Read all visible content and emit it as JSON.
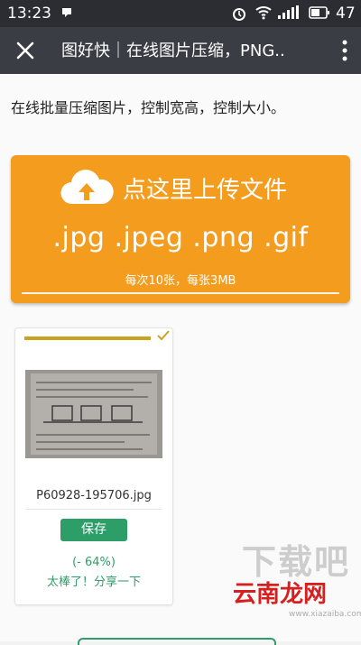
{
  "status_bar": {
    "time": "13:23",
    "battery": "47"
  },
  "title_bar": {
    "title": "图好快｜在线图片压缩，PNG.."
  },
  "main": {
    "intro": "在线批量压缩图片，控制宽高，控制大小。",
    "upload": {
      "title": "点这里上传文件",
      "extensions": ".jpg .jpeg .png .gif",
      "limit": "每次10张，每张3MB"
    },
    "file_card": {
      "filename": "P60928-195706.jpg",
      "save_label": "保存",
      "ratio": "(- 64%)",
      "share_label": "太棒了！分享一下",
      "progress_fraction": 1.0
    }
  },
  "watermark": {
    "big_text": "下载吧",
    "brand": "云南龙网",
    "url": "www.xiazaiba.com"
  },
  "colors": {
    "status_bar": "#2b2d33",
    "title_bar": "#3a3d44",
    "upload_orange": "#f39c1e",
    "green": "#2e9e69",
    "progress_gold": "#c9a421"
  }
}
